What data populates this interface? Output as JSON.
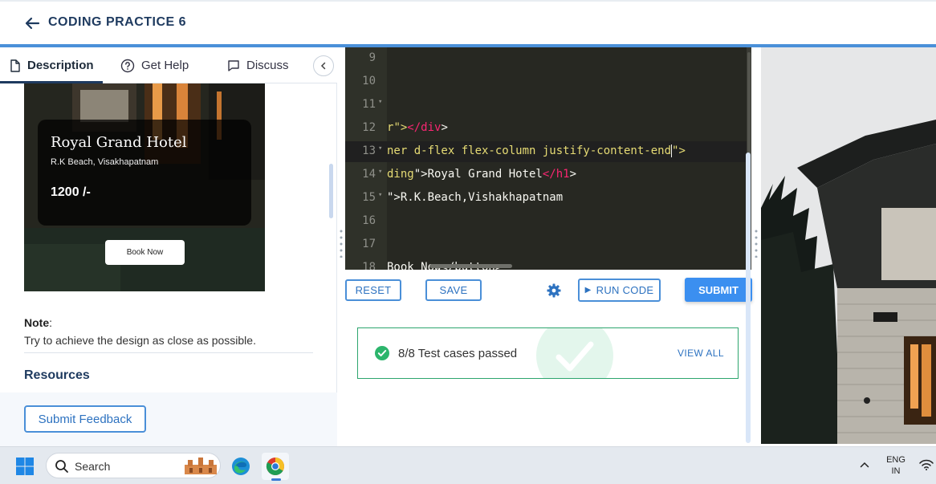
{
  "header": {
    "title": "CODING PRACTICE 6"
  },
  "tabs": [
    {
      "label": "Description"
    },
    {
      "label": "Get Help"
    },
    {
      "label": "Discuss"
    }
  ],
  "preview_card": {
    "hotel_name": "Royal Grand Hotel",
    "location": "R.K Beach, Visakhapatnam",
    "price": "1200 /-",
    "button": "Book Now"
  },
  "note": {
    "label": "Note",
    "text": "Try to achieve the design as close as possible."
  },
  "resources_heading": "Resources",
  "feedback_button": "Submit Feedback",
  "editor": {
    "line_numbers": [
      "9",
      "10",
      "11",
      "12",
      "13",
      "14",
      "15",
      "16",
      "17",
      "18"
    ],
    "lines": [
      {
        "a": "r",
        "b": "\">",
        "c": "</div",
        "d": ">"
      },
      {
        "a": "ner d-flex flex-column justify-content-end",
        "b": "\">"
      },
      {
        "a": "ding",
        "b": "\">Royal Grand Hotel",
        "c": "</h1",
        "d": ">"
      },
      {
        "a": "\">R.K.Beach,Vishakhapatnam"
      },
      {
        "a": "Book Now</button>"
      }
    ]
  },
  "actions": {
    "reset": "RESET",
    "save": "SAVE",
    "run_code": "RUN CODE",
    "submit": "SUBMIT"
  },
  "result": {
    "text": "8/8 Test cases passed",
    "view_all": "VIEW ALL"
  },
  "taskbar": {
    "search_placeholder": "Search",
    "lang_line1": "ENG",
    "lang_line2": "IN"
  },
  "colors": {
    "accent": "#4a90d9",
    "submit_bg": "#3b8ff0",
    "success": "#2da56e",
    "editor_bg": "#272822",
    "title": "#1e3a5f"
  }
}
